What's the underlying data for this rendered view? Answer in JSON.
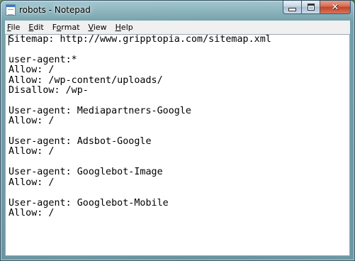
{
  "window": {
    "title": "robots - Notepad",
    "app_icon": "notepad-icon"
  },
  "caption_buttons": {
    "minimize": "minimize-icon",
    "maximize": "maximize-icon",
    "close": "close-icon",
    "close_glyph": "✕"
  },
  "menu": {
    "file": {
      "key": "F",
      "rest": "ile"
    },
    "edit": {
      "key": "E",
      "rest": "dit"
    },
    "format": {
      "pre": "F",
      "key": "o",
      "rest": "rmat"
    },
    "view": {
      "key": "V",
      "rest": "iew"
    },
    "help": {
      "key": "H",
      "rest": "elp"
    }
  },
  "document": {
    "lines": [
      "Sitemap: http://www.gripptopia.com/sitemap.xml",
      "",
      "user-agent:*",
      "Allow: /",
      "Allow: /wp-content/uploads/",
      "Disallow: /wp-",
      "",
      "User-agent: Mediapartners-Google",
      "Allow: /",
      "",
      "User-agent: Adsbot-Google",
      "Allow: /",
      "",
      "User-agent: Googlebot-Image",
      "Allow: /",
      "",
      "User-agent: Googlebot-Mobile",
      "Allow: /"
    ]
  }
}
